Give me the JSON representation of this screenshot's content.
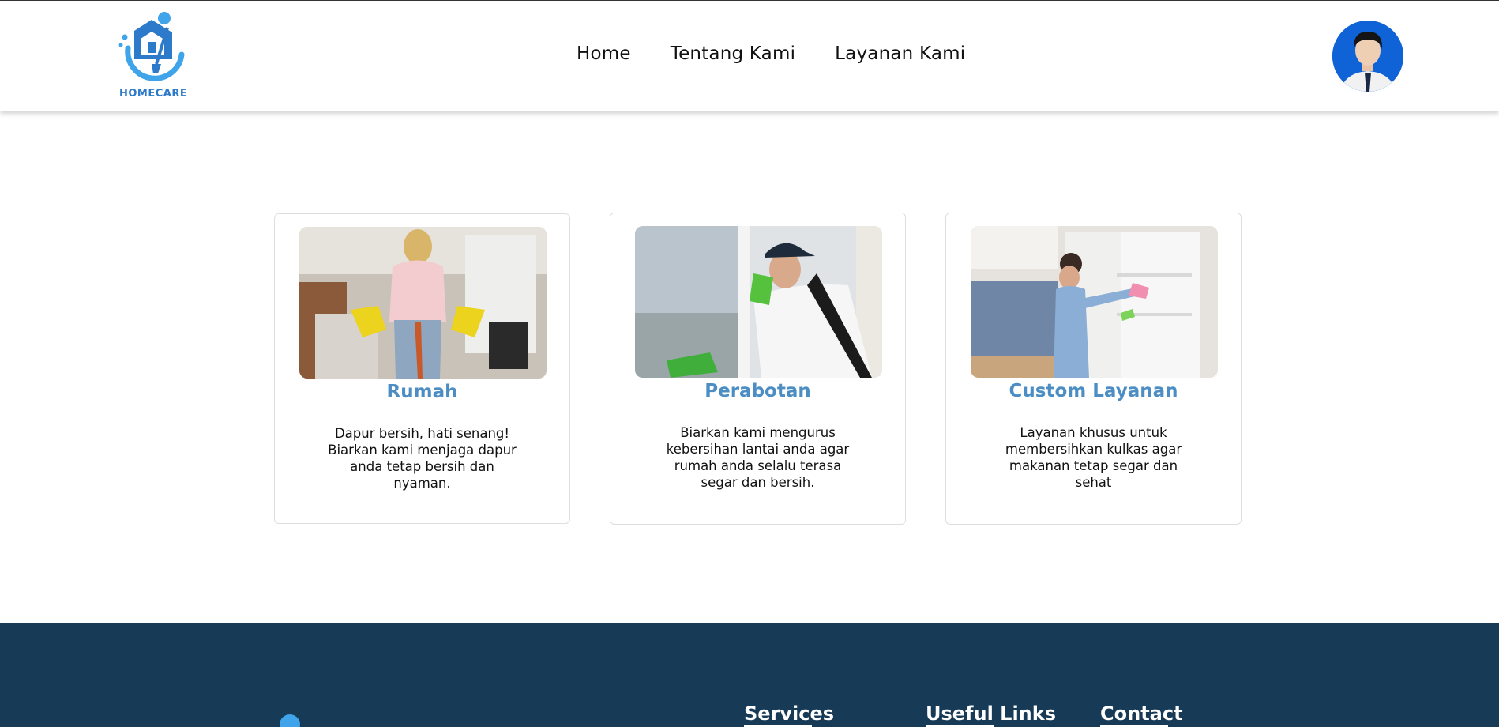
{
  "header": {
    "logo_text": "HOMECARE",
    "nav": [
      "Home",
      "Tentang Kami",
      "Layanan Kami"
    ]
  },
  "cards": [
    {
      "title": "Rumah",
      "desc": "Dapur bersih, hati senang! Biarkan kami menjaga dapur anda tetap bersih dan nyaman."
    },
    {
      "title": "Perabotan",
      "desc": "Biarkan kami mengurus kebersihan lantai anda agar rumah anda selalu terasa segar dan bersih."
    },
    {
      "title": "Custom Layanan",
      "desc": "Layanan khusus untuk membersihkan kulkas agar makanan tetap segar dan sehat"
    }
  ],
  "footer": {
    "headings": [
      "Services",
      "Useful Links",
      "Contact"
    ]
  },
  "colors": {
    "accent": "#4c8ec4",
    "logo_blue": "#2c7ac9",
    "footer_bg": "#173a56",
    "avatar_bg": "#0f63d6"
  }
}
